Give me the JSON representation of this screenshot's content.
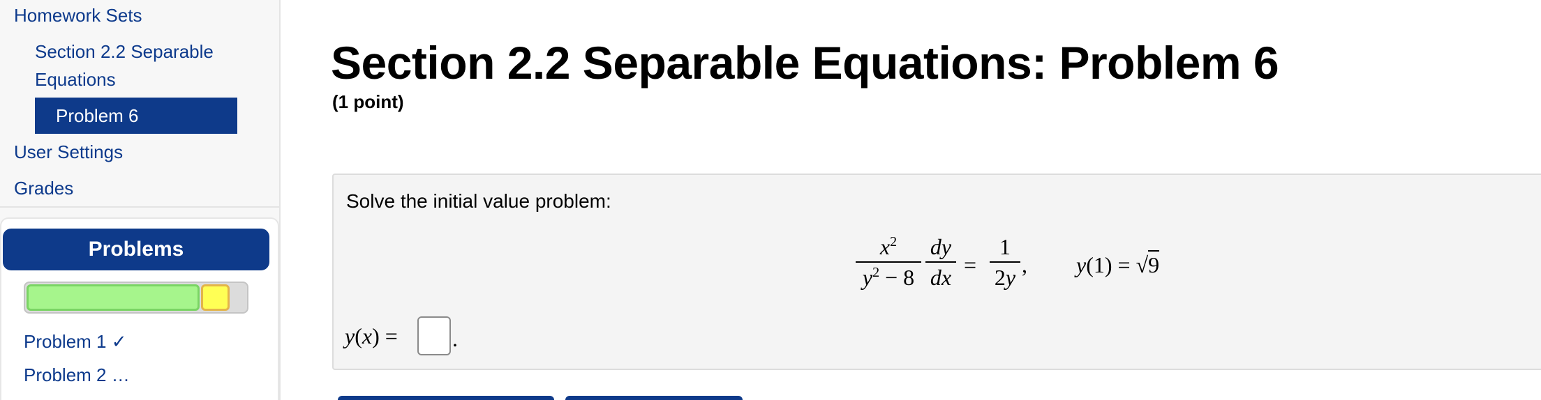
{
  "sidebar": {
    "homework_sets": "Homework Sets",
    "section_line1": "Section 2.2 Separable",
    "section_line2": "Equations",
    "current_problem": "Problem 6",
    "user_settings": "User Settings",
    "grades": "Grades"
  },
  "problems_panel": {
    "header": "Problems",
    "progress": {
      "correct_fraction": 0.79,
      "partial_fraction": 0.13,
      "correct_color": "#a6f58c",
      "partial_color": "#ffff55"
    },
    "items": [
      {
        "label": "Problem 1 ✓"
      },
      {
        "label": "Problem 2 …"
      }
    ]
  },
  "main": {
    "title": "Section 2.2 Separable Equations: Problem 6",
    "points": "(1 point)",
    "prompt": "Solve the initial value problem:",
    "answer_value": ""
  },
  "colors": {
    "accent": "#0e3a8a",
    "link": "#0d3a8c",
    "problem_bg": "#f4f4f4"
  }
}
